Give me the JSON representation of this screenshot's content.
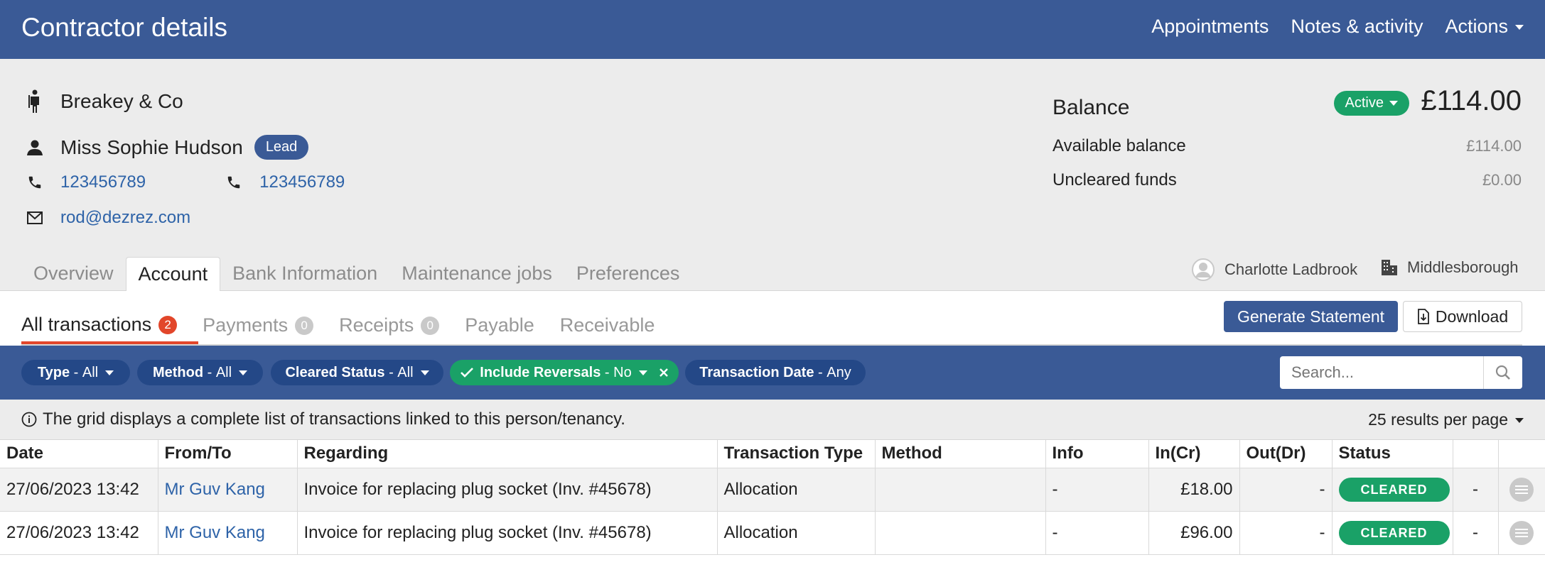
{
  "header": {
    "title": "Contractor details",
    "nav": [
      "Appointments",
      "Notes & activity",
      "Actions"
    ]
  },
  "contractor": {
    "company": "Breakey & Co",
    "contact_name": "Miss Sophie Hudson",
    "contact_badge": "Lead",
    "phone1": "123456789",
    "phone2": "123456789",
    "email": "rod@dezrez.com"
  },
  "balance": {
    "label": "Balance",
    "status": "Active",
    "amount": "£114.00",
    "available_label": "Available balance",
    "available_value": "£114.00",
    "uncleared_label": "Uncleared funds",
    "uncleared_value": "£0.00"
  },
  "tabs": [
    "Overview",
    "Account",
    "Bank Information",
    "Maintenance jobs",
    "Preferences"
  ],
  "active_tab": "Account",
  "owner": {
    "negotiator": "Charlotte Ladbrook",
    "branch": "Middlesborough"
  },
  "subtabs": [
    {
      "label": "All transactions",
      "count": "2"
    },
    {
      "label": "Payments",
      "count": "0"
    },
    {
      "label": "Receipts",
      "count": "0"
    },
    {
      "label": "Payable",
      "count": ""
    },
    {
      "label": "Receivable",
      "count": ""
    }
  ],
  "buttons": {
    "generate": "Generate Statement",
    "download": "Download"
  },
  "filters": {
    "type": {
      "label": "Type",
      "value": "All"
    },
    "method": {
      "label": "Method",
      "value": "All"
    },
    "cleared": {
      "label": "Cleared Status",
      "value": "All"
    },
    "reversals": {
      "label": "Include Reversals",
      "value": "No"
    },
    "date": {
      "label": "Transaction Date",
      "value": "Any"
    }
  },
  "search": {
    "placeholder": "Search..."
  },
  "notice": {
    "text": "The grid displays a complete list of transactions linked to this person/tenancy.",
    "per_page": "25 results per page"
  },
  "table": {
    "columns": [
      "Date",
      "From/To",
      "Regarding",
      "Transaction Type",
      "Method",
      "Info",
      "In(Cr)",
      "Out(Dr)",
      "Status",
      "",
      ""
    ],
    "rows": [
      {
        "date": "27/06/2023 13:42",
        "from_to": "Mr Guv Kang",
        "regarding": "Invoice for replacing plug socket (Inv. #45678)",
        "type": "Allocation",
        "method": "",
        "info": "-",
        "in": "£18.00",
        "out": "-",
        "status": "CLEARED",
        "extra": "-"
      },
      {
        "date": "27/06/2023 13:42",
        "from_to": "Mr Guv Kang",
        "regarding": "Invoice for replacing plug socket (Inv. #45678)",
        "type": "Allocation",
        "method": "",
        "info": "-",
        "in": "£96.00",
        "out": "-",
        "status": "CLEARED",
        "extra": "-"
      }
    ]
  },
  "colors": {
    "primary": "#3a5a96",
    "chip": "#244887",
    "green": "#1aa167",
    "accent_red": "#e2462a",
    "link": "#2e63a8"
  }
}
